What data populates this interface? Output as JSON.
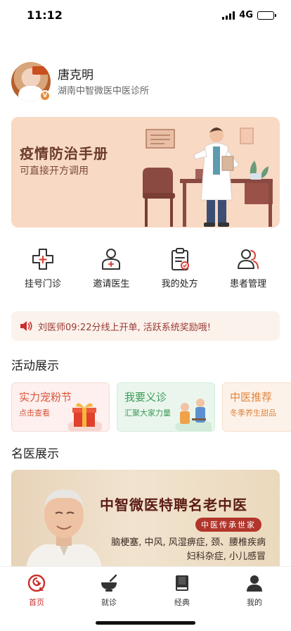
{
  "status": {
    "time": "11:12",
    "network": "4G"
  },
  "profile": {
    "name": "唐克明",
    "clinic": "湖南中智微医中医诊所",
    "badge": "V"
  },
  "banner": {
    "title": "疫情防治手册",
    "subtitle": "可直接开方调用"
  },
  "quick_actions": [
    {
      "label": "挂号门诊",
      "icon": "clinic-cross-icon"
    },
    {
      "label": "邀请医生",
      "icon": "invite-doctor-icon"
    },
    {
      "label": "我的处方",
      "icon": "prescription-icon"
    },
    {
      "label": "患者管理",
      "icon": "patients-icon"
    }
  ],
  "notice": {
    "text": "刘医师09:22分线上开单, 活跃系统奖励哦!"
  },
  "sections": {
    "activities": "活动展示",
    "famous": "名医展示"
  },
  "activities": [
    {
      "title": "实力宠粉节",
      "subtitle": "点击查看"
    },
    {
      "title": "我要义诊",
      "subtitle": "汇聚大家力量"
    },
    {
      "title": "中医推荐",
      "subtitle": "冬季养生甜品"
    }
  ],
  "famous": {
    "title": "中智微医特聘名老中医",
    "tag": "中医传承世家",
    "line1": "脑梗塞, 中风, 风湿痹症, 颈、腰椎疾病",
    "line2": "妇科杂症, 小儿感冒"
  },
  "tabs": [
    {
      "label": "首页",
      "icon": "home-icon"
    },
    {
      "label": "就诊",
      "icon": "medicine-bowl-icon"
    },
    {
      "label": "经典",
      "icon": "book-icon"
    },
    {
      "label": "我的",
      "icon": "user-icon"
    }
  ],
  "colors": {
    "accent": "#c9302c",
    "banner_bg": "#f8d9c4",
    "notice_text": "#9a3a32"
  }
}
